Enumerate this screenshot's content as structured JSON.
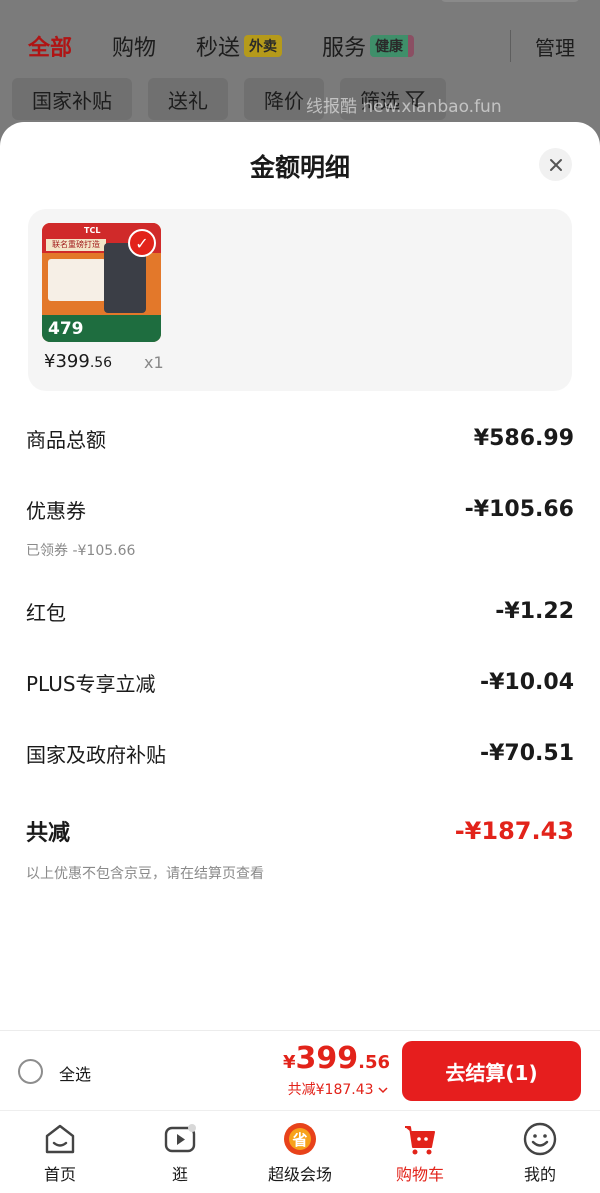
{
  "background": {
    "tabs": [
      {
        "label": "全部",
        "active": true
      },
      {
        "label": "购物"
      },
      {
        "label": "秒送",
        "badge": "外卖"
      },
      {
        "label": "服务",
        "badge": "健康"
      }
    ],
    "manage_label": "管理",
    "filters": [
      "国家补贴",
      "送礼",
      "降价",
      "筛选"
    ]
  },
  "watermark": "线报酷 new.xianbao.fun",
  "sheet": {
    "title": "金额明细",
    "close_icon": "close-icon",
    "product": {
      "thumb_brand": "TCL",
      "thumb_banner": "联名重磅打造",
      "thumb_price": "479",
      "price_symbol": "¥",
      "price_int": "399",
      "price_dec": ".56",
      "quantity": "x1",
      "selected": true
    },
    "rows": {
      "goods_total_label": "商品总额",
      "goods_total_value": "¥586.99",
      "coupon_label": "优惠券",
      "coupon_value": "-¥105.66",
      "coupon_sub": "已领券 -¥105.66",
      "redpacket_label": "红包",
      "redpacket_value": "-¥1.22",
      "plus_label": "PLUS专享立减",
      "plus_value": "-¥10.04",
      "subsidy_label": "国家及政府补贴",
      "subsidy_value": "-¥70.51",
      "total_label": "共减",
      "total_value": "-¥187.43",
      "note": "以上优惠不包含京豆，请在结算页查看"
    }
  },
  "checkout": {
    "select_all_label": "全选",
    "price_symbol": "¥",
    "price_int": "399",
    "price_dec": ".56",
    "discount_text": "共减¥187.43",
    "button_label": "去结算(1)"
  },
  "tabbar": [
    {
      "label": "首页",
      "icon": "home-icon"
    },
    {
      "label": "逛",
      "icon": "video-play-icon"
    },
    {
      "label": "超级会场",
      "icon": "super-venue-icon"
    },
    {
      "label": "购物车",
      "icon": "cart-icon",
      "active": true
    },
    {
      "label": "我的",
      "icon": "profile-face-icon"
    }
  ],
  "colors": {
    "accent": "#e2231a",
    "checkout_button": "#e61e1e",
    "overlay": "#7b7b7b"
  }
}
